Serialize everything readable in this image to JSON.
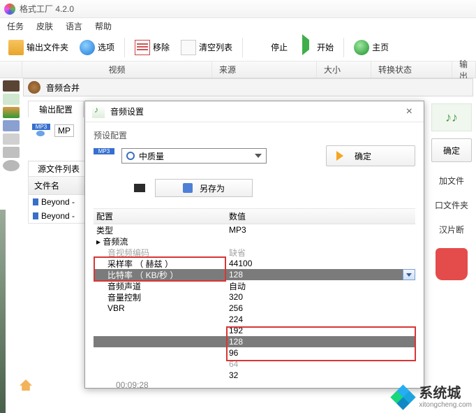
{
  "app": {
    "title": "格式工厂 4.2.0"
  },
  "menu": [
    "任务",
    "皮肤",
    "语言",
    "帮助"
  ],
  "toolbar": {
    "output_folder": "输出文件夹",
    "options": "选项",
    "remove": "移除",
    "clear": "清空列表",
    "stop": "停止",
    "start": "开始",
    "home": "主页"
  },
  "columns": {
    "video": "视频",
    "source": "来源",
    "size": "大小",
    "status": "转换状态",
    "output": "输出"
  },
  "merge_bar": "音频合并",
  "output_cfg": "输出配置",
  "mp3_label": "MP",
  "src_header": "源文件列表",
  "src_cols": {
    "name": "文件名"
  },
  "src_rows": [
    "Beyond -",
    "Beyond -"
  ],
  "dialog": {
    "title": "音频设置",
    "preset_label": "预设配置",
    "quality": "中质量",
    "ok": "确定",
    "save_as": "另存为",
    "grid_head": {
      "cfg": "配置",
      "value": "数值"
    },
    "rows": {
      "type_label": "类型",
      "type_val": "MP3",
      "stream": "音频流",
      "codec_label": "音视频编码",
      "codec_val": "缺省",
      "sample_label": "采样率 （ 赫兹 ）",
      "sample_val": "44100",
      "bitrate_label": "比特率 （ KB/秒 ）",
      "bitrate_val": "128",
      "channel_label": "音频声道",
      "channel_val": "自动",
      "volume_label": "音量控制",
      "v_320": "320",
      "vbr_label": "VBR",
      "v_256": "256",
      "v_224": "224",
      "v_192": "192",
      "v_128": "128",
      "v_96": "96",
      "v_64": "64",
      "v_32": "32"
    }
  },
  "right": {
    "ok": "确定",
    "add": "加文件",
    "open_folder": "口文件夹",
    "snip": "汉片断"
  },
  "bottom": {
    "time": "00:09:28"
  },
  "brand": {
    "name": "系统城",
    "url": "xitongcheng.com"
  }
}
